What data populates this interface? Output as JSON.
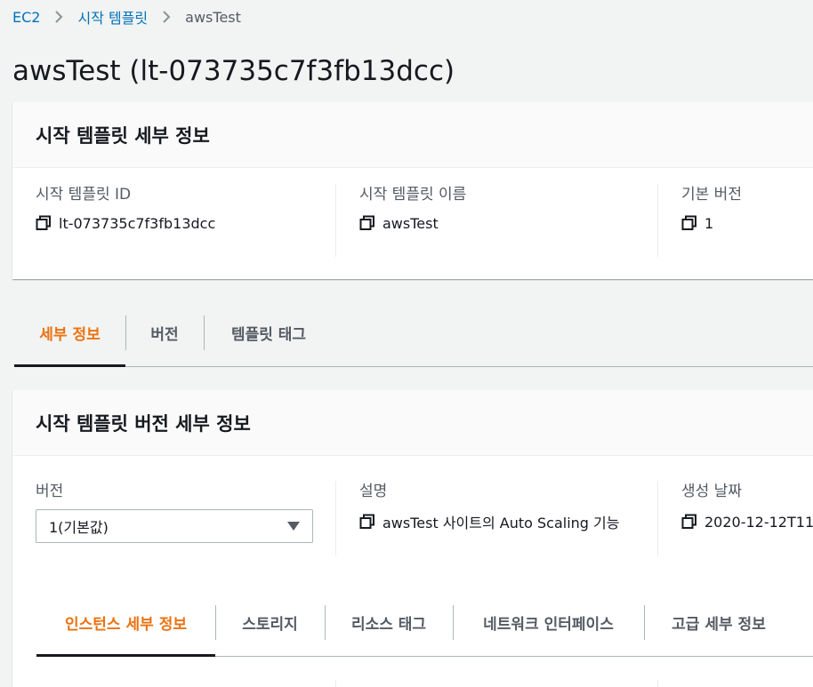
{
  "breadcrumb": {
    "items": [
      "EC2",
      "시작 템플릿"
    ],
    "current": "awsTest"
  },
  "page": {
    "title": "awsTest (lt-073735c7f3fb13dcc)"
  },
  "details_card": {
    "header": "시작 템플릿 세부 정보",
    "fields": [
      {
        "label": "시작 템플릿 ID",
        "value": "lt-073735c7f3fb13dcc"
      },
      {
        "label": "시작 템플릿 이름",
        "value": "awsTest"
      },
      {
        "label": "기본 버전",
        "value": "1"
      }
    ]
  },
  "main_tabs": {
    "items": [
      "세부 정보",
      "버전",
      "템플릿 태그"
    ],
    "active": "세부 정보"
  },
  "version_card": {
    "header": "시작 템플릿 버전 세부 정보",
    "version_label": "버전",
    "version_selected": "1(기본값)",
    "description_label": "설명",
    "description_value": "awsTest 사이트의 Auto Scaling 기능",
    "created_label": "생성 날짜",
    "created_value": "2020-12-12T11"
  },
  "sub_tabs": {
    "items": [
      "인스턴스 세부 정보",
      "스토리지",
      "리소스 태그",
      "네트워크 인터페이스",
      "고급 세부 정보"
    ],
    "active": "인스턴스 세부 정보"
  },
  "colors": {
    "link": "#0073bb",
    "active_tab": "#ec7211",
    "text": "#16191f",
    "muted": "#545b64"
  },
  "icons": {
    "breadcrumb_separator": "chevron-right-icon",
    "copy": "copy-icon",
    "select": "caret-down-icon"
  }
}
